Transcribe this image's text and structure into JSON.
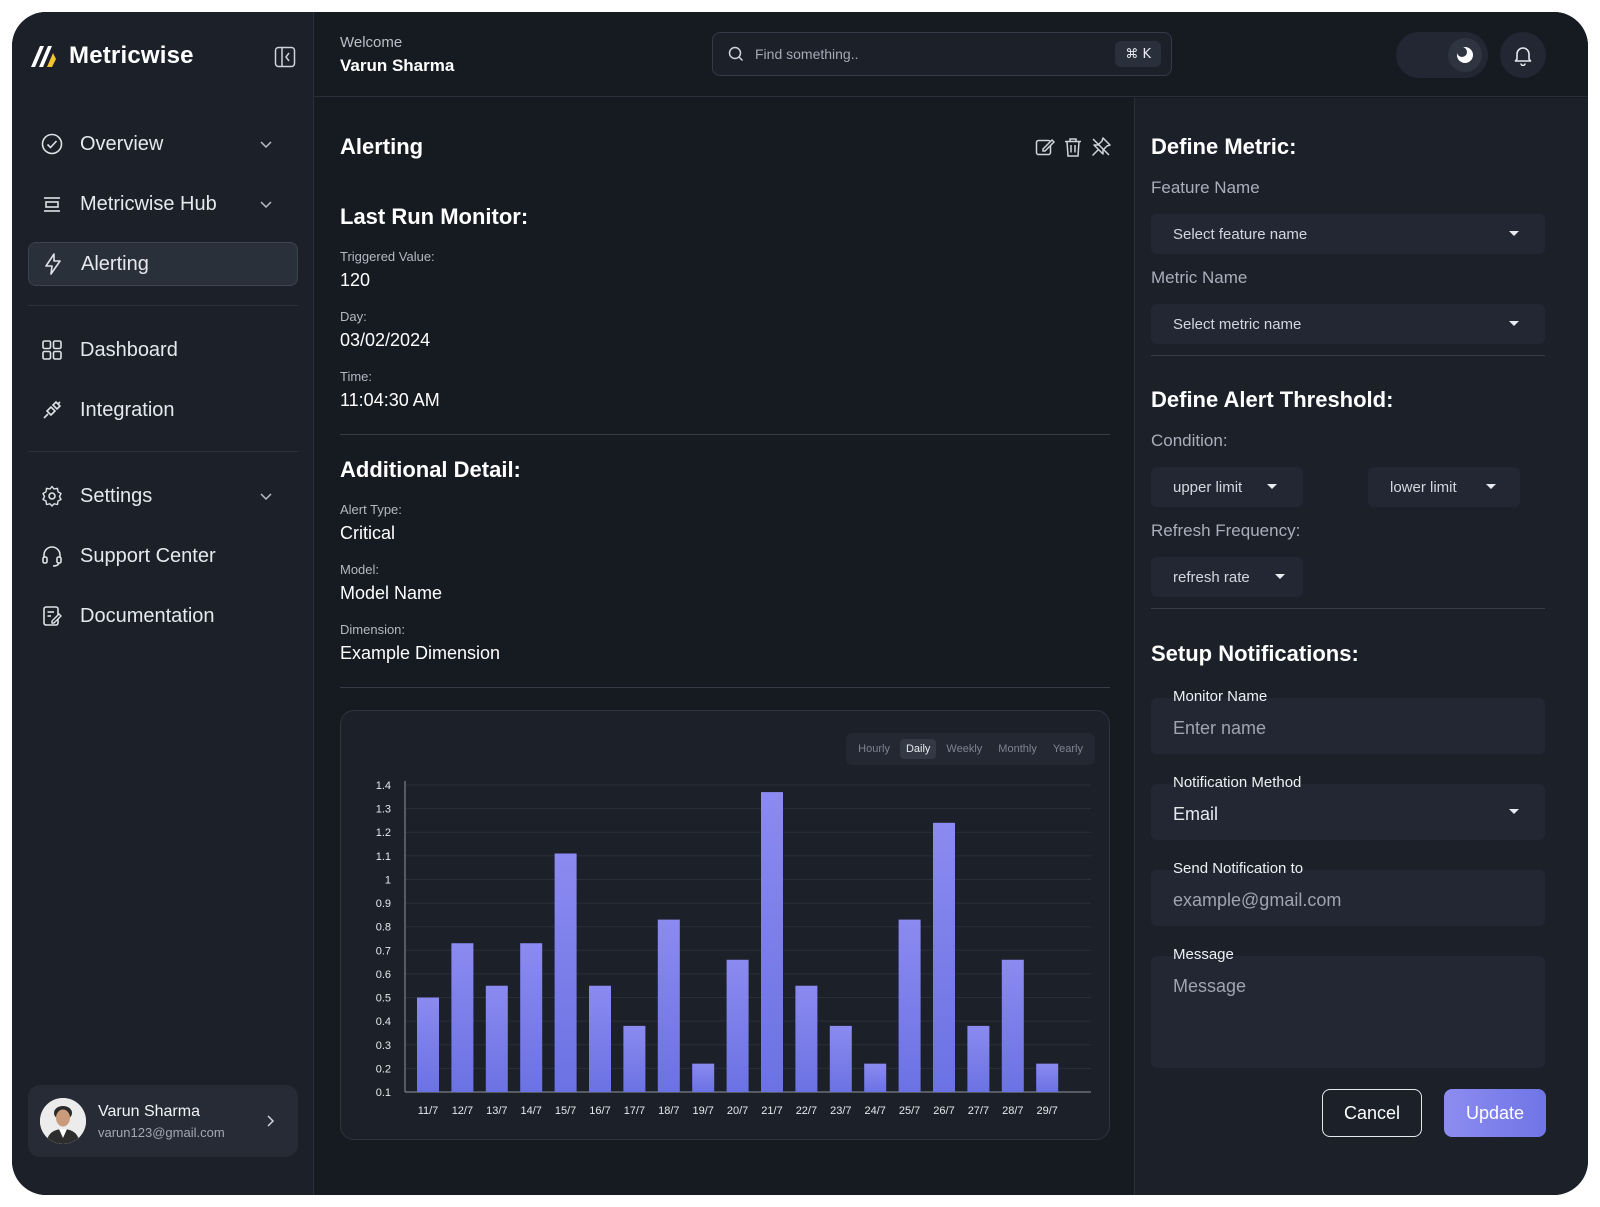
{
  "app": {
    "name": "Metricwise"
  },
  "sidebar": {
    "items": [
      {
        "label": "Overview",
        "icon": "check-circle-icon",
        "has_chevron": true
      },
      {
        "label": "Metricwise Hub",
        "icon": "hub-icon",
        "has_chevron": true
      },
      {
        "label": "Alerting",
        "icon": "lightning-icon",
        "active": true
      },
      {
        "label": "Dashboard",
        "icon": "grid-icon"
      },
      {
        "label": "Integration",
        "icon": "plug-icon"
      },
      {
        "label": "Settings",
        "icon": "gear-icon",
        "has_chevron": true
      },
      {
        "label": "Support Center",
        "icon": "headset-icon"
      },
      {
        "label": "Documentation",
        "icon": "document-icon"
      }
    ],
    "user": {
      "name": "Varun Sharma",
      "email": "varun123@gmail.com"
    }
  },
  "header": {
    "welcome": "Welcome",
    "user_name": "Varun Sharma",
    "search_placeholder": "Find something..",
    "shortcut": "⌘ K"
  },
  "main": {
    "title": "Alerting",
    "last_run": {
      "title": "Last Run Monitor:",
      "fields": [
        {
          "label": "Triggered Value:",
          "value": "120"
        },
        {
          "label": "Day:",
          "value": "03/02/2024"
        },
        {
          "label": "Time:",
          "value": "11:04:30 AM"
        }
      ]
    },
    "additional": {
      "title": "Additional Detail:",
      "fields": [
        {
          "label": "Alert Type:",
          "value": "Critical"
        },
        {
          "label": "Model:",
          "value": "Model Name"
        },
        {
          "label": "Dimension:",
          "value": "Example Dimension"
        }
      ]
    },
    "range_tabs": [
      "Hourly",
      "Daily",
      "Weekly",
      "Monthly",
      "Yearly"
    ],
    "range_selected": "Daily"
  },
  "chart_data": {
    "type": "bar",
    "categories": [
      "11/7",
      "12/7",
      "13/7",
      "14/7",
      "15/7",
      "16/7",
      "17/7",
      "18/7",
      "19/7",
      "20/7",
      "21/7",
      "22/7",
      "23/7",
      "24/7",
      "25/7",
      "26/7",
      "27/7",
      "28/7",
      "29/7"
    ],
    "values": [
      0.5,
      0.73,
      0.55,
      0.73,
      1.11,
      0.55,
      0.38,
      0.83,
      0.22,
      0.66,
      1.37,
      0.55,
      0.38,
      0.22,
      0.83,
      1.24,
      0.38,
      0.66,
      0.22
    ],
    "yticks": [
      "0.1",
      "0.2",
      "0.3",
      "0.4",
      "0.5",
      "0.6",
      "0.7",
      "0.8",
      "0.9",
      "1",
      "1.1",
      "1.2",
      "1.3",
      "1.4"
    ],
    "ylim": [
      0.1,
      1.4
    ],
    "grid": true,
    "bar_color_top": "#8b8af0",
    "bar_color_bottom": "#6b72e3"
  },
  "panel": {
    "define_metric": "Define Metric:",
    "feature_label": "Feature Name",
    "feature_placeholder": "Select feature name",
    "metric_label": "Metric Name",
    "metric_placeholder": "Select metric name",
    "threshold_title": "Define Alert Threshold:",
    "condition_label": "Condition:",
    "upper": "upper limit",
    "lower": "lower limit",
    "refresh_label": "Refresh Frequency:",
    "refresh": "refresh rate",
    "notif_title": "Setup Notifications:",
    "monitor_label": "Monitor Name",
    "monitor_placeholder": "Enter name",
    "method_label": "Notification Method",
    "method_value": "Email",
    "send_label": "Send Notification to",
    "send_placeholder": "example@gmail.com",
    "message_label": "Message",
    "message_placeholder": "Message",
    "cancel": "Cancel",
    "update": "Update"
  },
  "colors": {
    "background": "#161a21",
    "surface": "#1b2029",
    "accent": "#7c7ff0"
  }
}
